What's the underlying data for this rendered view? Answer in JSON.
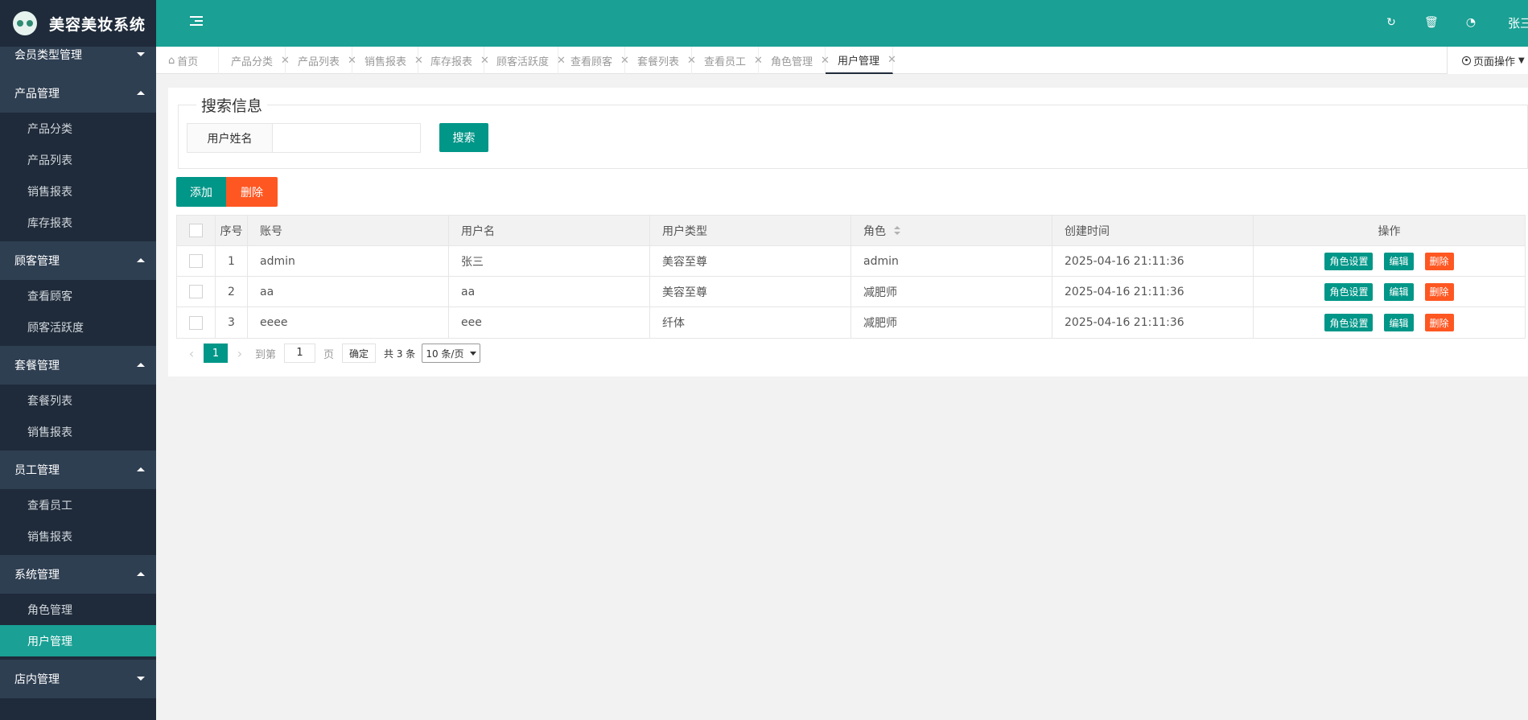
{
  "app": {
    "title": "美容美妆系统",
    "user": "张三"
  },
  "header": {
    "icons": [
      "refresh-icon",
      "trash-icon",
      "dashboard-icon"
    ]
  },
  "sidebar": {
    "groups": [
      {
        "label": "会员类型管理",
        "expanded": false,
        "items": []
      },
      {
        "label": "产品管理",
        "expanded": true,
        "items": [
          "产品分类",
          "产品列表",
          "销售报表",
          "库存报表"
        ]
      },
      {
        "label": "顾客管理",
        "expanded": true,
        "items": [
          "查看顾客",
          "顾客活跃度"
        ]
      },
      {
        "label": "套餐管理",
        "expanded": true,
        "items": [
          "套餐列表",
          "销售报表"
        ]
      },
      {
        "label": "员工管理",
        "expanded": true,
        "items": [
          "查看员工",
          "销售报表"
        ]
      },
      {
        "label": "系统管理",
        "expanded": true,
        "items": [
          "角色管理",
          "用户管理"
        ]
      },
      {
        "label": "店内管理",
        "expanded": false,
        "items": []
      }
    ],
    "active_item": "用户管理"
  },
  "tabs": [
    {
      "label": "首页",
      "closable": false
    },
    {
      "label": "产品分类",
      "closable": true
    },
    {
      "label": "产品列表",
      "closable": true
    },
    {
      "label": "销售报表",
      "closable": true
    },
    {
      "label": "库存报表",
      "closable": true
    },
    {
      "label": "顾客活跃度",
      "closable": true
    },
    {
      "label": "查看顾客",
      "closable": true
    },
    {
      "label": "套餐列表",
      "closable": true
    },
    {
      "label": "查看员工",
      "closable": true
    },
    {
      "label": "角色管理",
      "closable": true
    },
    {
      "label": "用户管理",
      "closable": true,
      "active": true
    }
  ],
  "page_ops": "页面操作",
  "search": {
    "legend": "搜索信息",
    "field_label": "用户姓名",
    "value": "",
    "button": "搜索"
  },
  "toolbar": {
    "add": "添加",
    "delete": "删除"
  },
  "table": {
    "columns": [
      "序号",
      "账号",
      "用户名",
      "用户类型",
      "角色",
      "创建时间",
      "操作"
    ],
    "rows": [
      {
        "no": "1",
        "account": "admin",
        "name": "张三",
        "type": "美容至尊",
        "role": "admin",
        "created": "2025-04-16 21:11:36"
      },
      {
        "no": "2",
        "account": "aa",
        "name": "aa",
        "type": "美容至尊",
        "role": "减肥师",
        "created": "2025-04-16 21:11:36"
      },
      {
        "no": "3",
        "account": "eeee",
        "name": "eee",
        "type": "纤体",
        "role": "减肥师",
        "created": "2025-04-16 21:11:36"
      }
    ],
    "row_actions": {
      "role": "角色设置",
      "edit": "编辑",
      "delete": "删除"
    }
  },
  "pager": {
    "current": "1",
    "goto_label": "到第",
    "goto_value": "1",
    "page_unit": "页",
    "confirm": "确定",
    "total": "共 3 条",
    "page_size": "10 条/页"
  },
  "colors": {
    "primary": "#009688",
    "header": "#1aa094",
    "sidebar": "#1f2b3a",
    "danger": "#ff5722"
  }
}
